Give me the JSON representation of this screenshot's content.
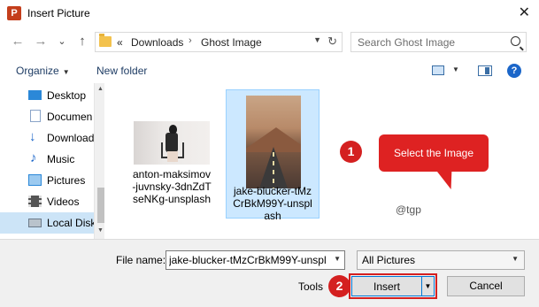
{
  "window": {
    "title": "Insert Picture",
    "app_icon_letter": "P"
  },
  "nav": {
    "back_glyph": "←",
    "forward_glyph": "→",
    "recent_glyph": "⌄",
    "up_glyph": "↑",
    "crumb_prefix": "«",
    "crumbs": [
      "Downloads",
      "Ghost Image"
    ],
    "separator": "›",
    "search_placeholder": "Search Ghost Image"
  },
  "toolbar": {
    "organize": "Organize",
    "new_folder": "New folder",
    "help": "?"
  },
  "sidebar": {
    "items": [
      {
        "label": "Desktop",
        "icon": "desktop-icon",
        "color": "#2b88d8"
      },
      {
        "label": "Documen",
        "icon": "documents-icon",
        "color": "#8aa4c8"
      },
      {
        "label": "Download",
        "icon": "downloads-icon",
        "color": "#1b66c9"
      },
      {
        "label": "Music",
        "icon": "music-icon",
        "color": "#1b66c9"
      },
      {
        "label": "Pictures",
        "icon": "pictures-icon",
        "color": "#2b88d8"
      },
      {
        "label": "Videos",
        "icon": "videos-icon",
        "color": "#555555"
      },
      {
        "label": "Local Disk",
        "icon": "local-disk-icon",
        "color": "#6c7a89"
      }
    ]
  },
  "files": [
    {
      "name_lines": [
        "anton-maksimov",
        "-juvnsky-3dnZdT",
        "seNKg-unsplash"
      ],
      "selected": false
    },
    {
      "name_lines": [
        "jake-blucker-tMz",
        "CrBkM99Y-unspl",
        "ash"
      ],
      "selected": true
    }
  ],
  "annotations": {
    "step1_number": "1",
    "step1_text": "Select the Image",
    "step2_number": "2",
    "watermark": "@tgp"
  },
  "bottom": {
    "file_name_label": "File name:",
    "file_name_value": "jake-blucker-tMzCrBkM99Y-unspl",
    "filter_value": "All Pictures",
    "tools_label": "Tools",
    "insert_label": "Insert",
    "cancel_label": "Cancel"
  },
  "colors": {
    "accent": "#0078d7",
    "callout_red": "#de2222",
    "selection": "#cce8ff"
  }
}
